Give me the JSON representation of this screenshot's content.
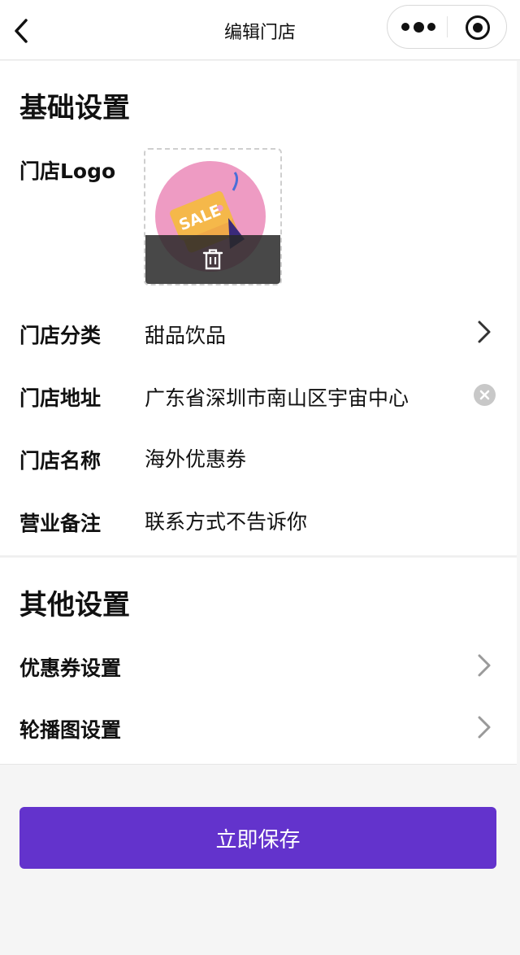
{
  "navbar": {
    "title": "编辑门店"
  },
  "basic": {
    "section_title": "基础设置",
    "logo_label": "门店Logo",
    "logo_image_text": "SALE",
    "rows": [
      {
        "label": "门店分类",
        "value": "甜品饮品",
        "action": "chevron-right-icon"
      },
      {
        "label": "门店地址",
        "value": "广东省深圳市南山区宇宙中心",
        "action": "clear-icon"
      },
      {
        "label": "门店名称",
        "value": "海外优惠券"
      },
      {
        "label": "营业备注",
        "value": "联系方式不告诉你"
      }
    ]
  },
  "other": {
    "section_title": "其他设置",
    "rows": [
      {
        "label": "优惠券设置",
        "action": "chevron-right-icon"
      },
      {
        "label": "轮播图设置",
        "action": "chevron-right-icon"
      }
    ]
  },
  "save_button": {
    "label": "立即保存"
  },
  "colors": {
    "primary": "#6333cc",
    "background": "#f5f5f5",
    "logo_circle": "#ee9bc3",
    "sale_tag": "#f5b84a"
  }
}
